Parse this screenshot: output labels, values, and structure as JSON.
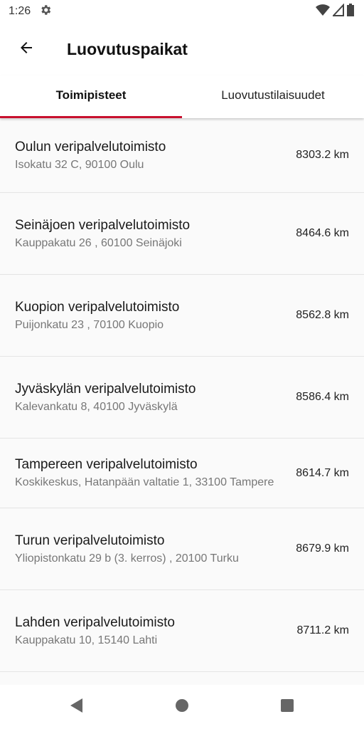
{
  "status_bar": {
    "time": "1:26"
  },
  "app_bar": {
    "title": "Luovutuspaikat"
  },
  "tabs": [
    {
      "label": "Toimipisteet",
      "active": true
    },
    {
      "label": "Luovutustilaisuudet",
      "active": false
    }
  ],
  "offices": [
    {
      "name": "Oulun veripalvelutoimisto",
      "address": "Isokatu 32 C, 90100  Oulu",
      "distance": "8303.2 km"
    },
    {
      "name": "Seinäjoen veripalvelutoimisto",
      "address": "Kauppakatu 26 , 60100 Seinäjoki",
      "distance": "8464.6 km"
    },
    {
      "name": "Kuopion veripalvelutoimisto",
      "address": "Puijonkatu 23 , 70100 Kuopio",
      "distance": "8562.8 km"
    },
    {
      "name": "Jyväskylän veripalvelutoimisto",
      "address": "Kalevankatu 8, 40100 Jyväskylä",
      "distance": "8586.4 km"
    },
    {
      "name": "Tampereen veripalvelutoimisto",
      "address": "Koskikeskus, Hatanpään valtatie 1, 33100 Tampere",
      "distance": "8614.7 km"
    },
    {
      "name": "Turun veripalvelutoimisto",
      "address": "Yliopistonkatu 29 b (3. kerros) , 20100 Turku",
      "distance": "8679.9 km"
    },
    {
      "name": "Lahden veripalvelutoimisto",
      "address": "Kauppakatu 10, 15140 Lahti",
      "distance": "8711.2 km"
    }
  ],
  "colors": {
    "accent": "#c8102e",
    "background": "#fafafa"
  },
  "icons": [
    "gear-icon",
    "wifi-icon",
    "signal-icon",
    "battery-icon",
    "back-arrow-icon",
    "nav-back-icon",
    "nav-home-icon",
    "nav-recents-icon"
  ]
}
